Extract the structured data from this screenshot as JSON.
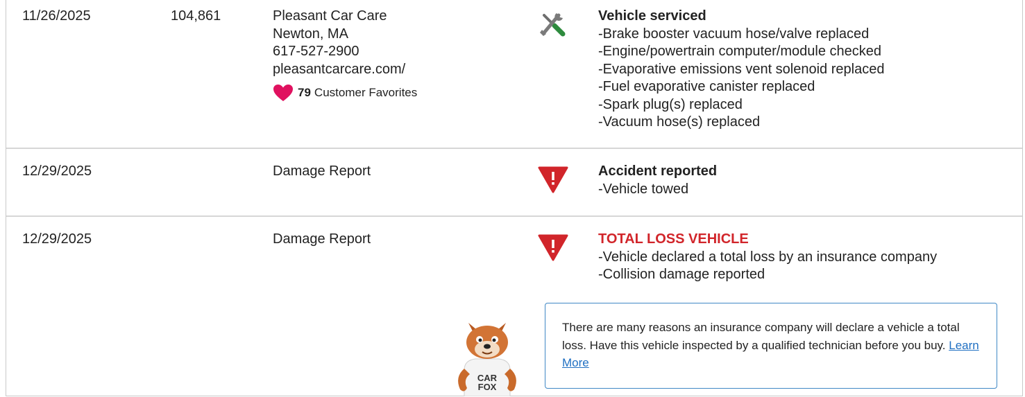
{
  "records": [
    {
      "date": "11/26/2025",
      "odometer": "104,861",
      "source": [
        "Pleasant Car Care",
        "Newton, MA",
        "617-527-2900",
        "pleasantcarcare.com/"
      ],
      "favorites": {
        "count": "79",
        "label": "Customer Favorites"
      },
      "icon": "wrench-screwdriver-icon",
      "title": "Vehicle serviced",
      "details": [
        "Brake booster vacuum hose/valve replaced",
        "Engine/powertrain computer/module checked",
        "Evaporative emissions vent solenoid replaced",
        "Fuel evaporative canister replaced",
        "Spark plug(s) replaced",
        "Vacuum hose(s) replaced"
      ]
    },
    {
      "date": "12/29/2025",
      "odometer": "",
      "source": [
        "Damage Report"
      ],
      "icon": "warning-triangle-icon",
      "title": "Accident reported",
      "details": [
        "Vehicle towed"
      ]
    },
    {
      "date": "12/29/2025",
      "odometer": "",
      "source": [
        "Damage Report"
      ],
      "icon": "warning-triangle-icon",
      "title": "TOTAL LOSS VEHICLE",
      "details": [
        "Vehicle declared a total loss by an insurance company",
        "Collision damage reported"
      ]
    }
  ],
  "callout": {
    "text": "There are many reasons an insurance company will declare a vehicle a total loss. Have this vehicle inspected by a qualified technician before you buy.",
    "link": "Learn More"
  },
  "mascot": {
    "shirt_line1": "CAR",
    "shirt_line2": "FOX"
  },
  "colors": {
    "alert_red": "#d1252a",
    "heart_pink": "#e0115f",
    "callout_border": "#3f88c5",
    "link_blue": "#1f6fc2"
  }
}
